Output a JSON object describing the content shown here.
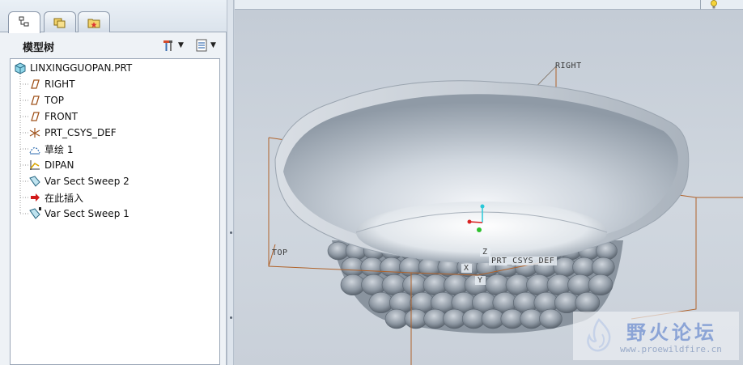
{
  "left_panel": {
    "tabs": [
      {
        "icon": "model-tree-tab-icon",
        "active": true
      },
      {
        "icon": "folder-browser-tab-icon",
        "active": false
      },
      {
        "icon": "favorites-tab-icon",
        "active": false
      }
    ],
    "tree_title": "模型树",
    "settings_button_icon": "tools-icon",
    "show_button_icon": "show-list-icon",
    "tree_items": [
      {
        "label": "LINXINGGUOPAN.PRT",
        "icon": "part-icon"
      },
      {
        "label": "RIGHT",
        "icon": "datum-plane-icon"
      },
      {
        "label": "TOP",
        "icon": "datum-plane-icon"
      },
      {
        "label": "FRONT",
        "icon": "datum-plane-icon"
      },
      {
        "label": "PRT_CSYS_DEF",
        "icon": "csys-icon"
      },
      {
        "label": "草绘 1",
        "icon": "sketch-icon"
      },
      {
        "label": "DIPAN",
        "icon": "datum-curve-icon"
      },
      {
        "label": "Var Sect Sweep 2",
        "icon": "sweep-icon"
      },
      {
        "label": "在此插入",
        "icon": "insert-here-arrow-icon"
      },
      {
        "label": "Var Sect Sweep 1",
        "icon": "sweep-icon"
      }
    ]
  },
  "viewport": {
    "datum_labels": {
      "right": "RIGHT",
      "top": "TOP",
      "csys": "PRT_CSYS_DEF",
      "axis_z": "Z",
      "axis_y": "Y",
      "axis_x": "X"
    },
    "colors": {
      "datum_plane": "#b0622a",
      "background": "#c8d0da"
    }
  },
  "watermark": {
    "title": "野火论坛",
    "url": "www.proewildfire.cn"
  }
}
